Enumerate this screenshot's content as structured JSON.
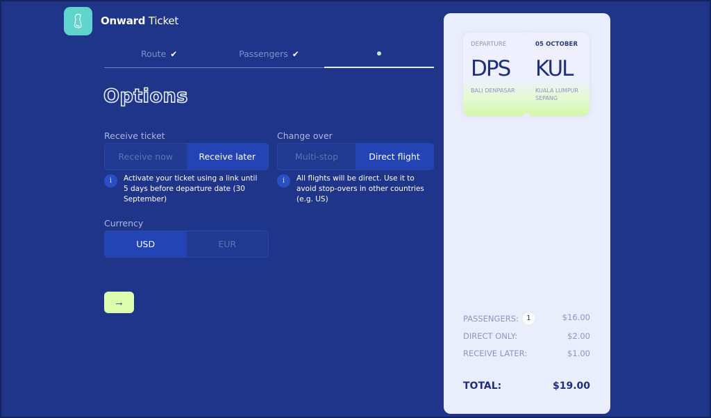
{
  "app": {
    "brand_bold": "Onward",
    "brand_rest": " Ticket",
    "logo_icon": "ticket-icon"
  },
  "steps": [
    {
      "label": "Route",
      "status": "done",
      "icon": "check-icon"
    },
    {
      "label": "Passengers",
      "status": "done",
      "icon": "check-icon"
    },
    {
      "label": "",
      "status": "current",
      "icon": "dot-icon"
    }
  ],
  "page_title": "Options",
  "receive_ticket": {
    "label": "Receive ticket",
    "options": [
      "Receive now",
      "Receive later"
    ],
    "selected": "Receive later",
    "info": "Activate your ticket using a link until 5 days before departure date (30 September)"
  },
  "change_over": {
    "label": "Change over",
    "options": [
      "Multi-stop",
      "Direct flight"
    ],
    "selected": "Direct flight",
    "info": "All flights will be direct. Use it to avoid stop-overs in other countries (e.g. US)"
  },
  "currency": {
    "label": "Currency",
    "options": [
      "USD",
      "EUR"
    ],
    "selected": "USD"
  },
  "next_button": {
    "label": "→",
    "icon": "arrow-right-icon"
  },
  "info_icon_glyph": "i",
  "ticket": {
    "departure_label": "DEPARTURE",
    "date": "05 OCTOBER",
    "from_code": "DPS",
    "from_city": "BALI DENPASAR",
    "to_code": "KUL",
    "to_city": "KUALA LUMPUR SEPANG"
  },
  "summary": {
    "lines": [
      {
        "label": "PASSENGERS:",
        "badge": "1",
        "amount": "$16.00"
      },
      {
        "label": "DIRECT ONLY:",
        "amount": "$2.00"
      },
      {
        "label": "RECEIVE LATER:",
        "amount": "$1.00"
      }
    ],
    "total_label": "TOTAL:",
    "total_amount": "$19.00"
  },
  "colors": {
    "background": "#1e3589",
    "accent_selected": "#2444b6",
    "logo": "#5fd3cc",
    "next_button": "#dcfcb0",
    "summary_panel": "#eaedfc"
  }
}
